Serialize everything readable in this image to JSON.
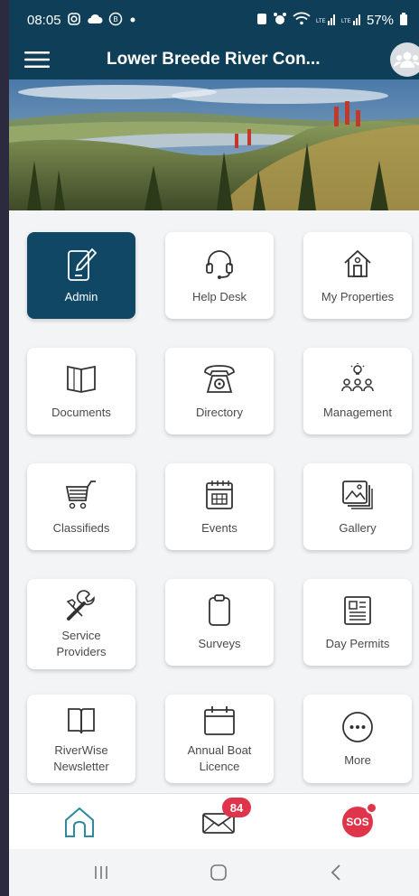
{
  "status_bar": {
    "time": "08:05",
    "battery": "57%",
    "network_label_1": "Vo))\nLTE1",
    "network_label_2": "Vo))\nLTE2"
  },
  "app_bar": {
    "title": "Lower Breede River Con..."
  },
  "tiles": [
    {
      "label": "Admin",
      "icon": "admin-icon"
    },
    {
      "label": "Help Desk",
      "icon": "headset-icon"
    },
    {
      "label": "My Properties",
      "icon": "house-icon"
    },
    {
      "label": "Documents",
      "icon": "book-open-icon"
    },
    {
      "label": "Directory",
      "icon": "phone-icon"
    },
    {
      "label": "Management",
      "icon": "team-bulb-icon"
    },
    {
      "label": "Classifieds",
      "icon": "cart-icon"
    },
    {
      "label": "Events",
      "icon": "calendar-grid-icon"
    },
    {
      "label": "Gallery",
      "icon": "gallery-icon"
    },
    {
      "label": "Service\nProviders",
      "icon": "tools-icon"
    },
    {
      "label": "Surveys",
      "icon": "clipboard-icon"
    },
    {
      "label": "Day Permits",
      "icon": "newspaper-icon"
    },
    {
      "label": "RiverWise\nNewsletter",
      "icon": "newsletter-book-icon"
    },
    {
      "label": "Annual Boat\nLicence",
      "icon": "calendar-icon"
    },
    {
      "label": "More",
      "icon": "more-icon"
    }
  ],
  "bottom_nav": {
    "home_icon": "home-icon",
    "mail_icon": "mail-icon",
    "mail_badge": "84",
    "sos_label": "SOS"
  },
  "colors": {
    "primary": "#0f3f58",
    "active_tile": "#0f4765",
    "badge": "#e0344b",
    "icon_teal": "#2e8a9e"
  }
}
